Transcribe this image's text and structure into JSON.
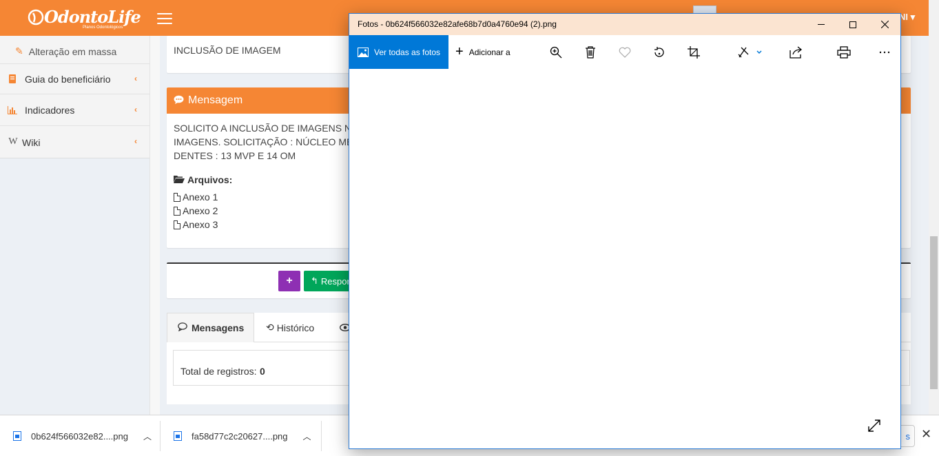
{
  "brand": {
    "logo_text": "OdontoLife",
    "logo_subtitle": "Planos Odontológicos",
    "accent_color": "#f58634"
  },
  "topbar": {
    "user_text": "NI ▾"
  },
  "sidebar": {
    "sub_item": "Alteração em massa",
    "items": [
      {
        "label": "Guia do beneficiário",
        "icon": "book-icon"
      },
      {
        "label": "Indicadores",
        "icon": "bar-chart-icon"
      },
      {
        "label": "Wiki",
        "icon": "wikipedia-icon"
      }
    ]
  },
  "main": {
    "top_text": "INCLUSÃO DE IMAGEM",
    "message_header": "Mensagem",
    "message_lines": [
      "SOLICITO A INCLUSÃO DE IMAGENS N",
      "IMAGENS. SOLICITAÇÃO : NÚCLEO ME",
      "DENTES : 13 MVP E 14 OM"
    ],
    "files_label": "Arquivos:",
    "files": [
      "Anexo 1",
      "Anexo 2",
      "Anexo 3"
    ],
    "plus_label": "+",
    "reply_label": "Respor",
    "tabs": [
      {
        "label": "Mensagens"
      },
      {
        "label": "Histórico"
      }
    ],
    "total_label": "Total de registros:",
    "total_value": "0"
  },
  "downloads": {
    "items": [
      {
        "name": "0b624f566032e82....png"
      },
      {
        "name": "fa58d77c2c20627....png"
      }
    ],
    "show_all_label": "s"
  },
  "photos": {
    "title": "Fotos - 0b624f566032e82afe68b7d0a4760e94 (2).png",
    "see_all_label": "Ver todas as fotos",
    "add_label": "Adicionar a",
    "toolbar_icons": [
      "zoom-icon",
      "delete-icon",
      "favorite-icon",
      "rotate-icon",
      "crop-icon",
      "edit-icon",
      "share-icon",
      "print-icon",
      "more-icon"
    ]
  }
}
